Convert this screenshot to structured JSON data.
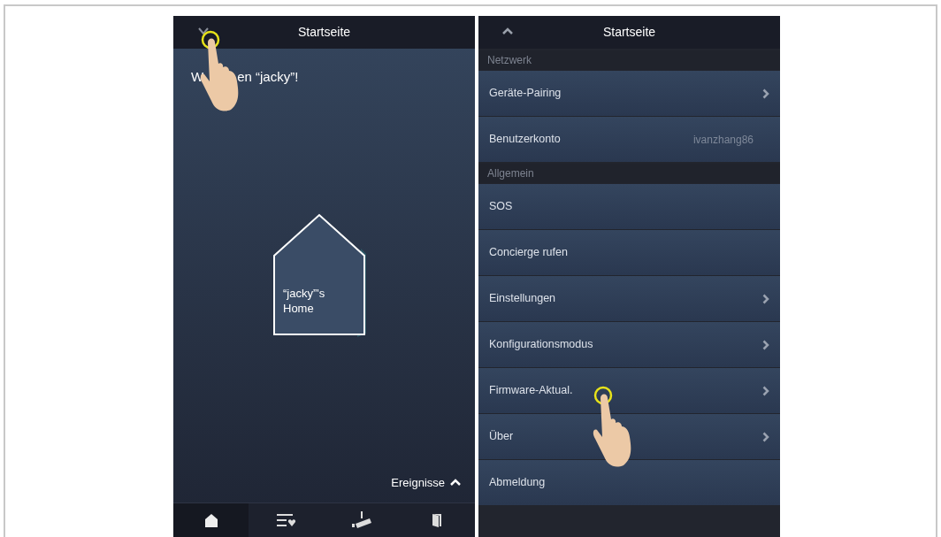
{
  "left_screen": {
    "title": "Startseite",
    "welcome_parts": [
      "W",
      "en “jacky”!"
    ],
    "home_label": "“jacky”'s Home",
    "events_label": "Ereignisse",
    "tabs": [
      {
        "selected": true
      },
      {
        "selected": false
      },
      {
        "selected": false
      },
      {
        "selected": false
      }
    ]
  },
  "right_screen": {
    "title": "Startseite",
    "sections": [
      {
        "title": "Netzwerk",
        "rows": [
          {
            "kind": "nav",
            "label": "Geräte-Pairing"
          },
          {
            "kind": "value",
            "label": "Benutzerkonto",
            "value": "ivanzhang86"
          }
        ]
      },
      {
        "title": "Allgemein",
        "rows": [
          {
            "kind": "plain",
            "label": "SOS"
          },
          {
            "kind": "plain",
            "label": "Concierge rufen"
          },
          {
            "kind": "nav",
            "label": "Einstellungen"
          },
          {
            "kind": "nav",
            "label": "Konfigurationsmodus"
          },
          {
            "kind": "nav",
            "label": "Firmware-Aktual."
          },
          {
            "kind": "nav",
            "label": "Über"
          },
          {
            "kind": "plain",
            "label": "Abmeldung"
          }
        ]
      }
    ]
  }
}
